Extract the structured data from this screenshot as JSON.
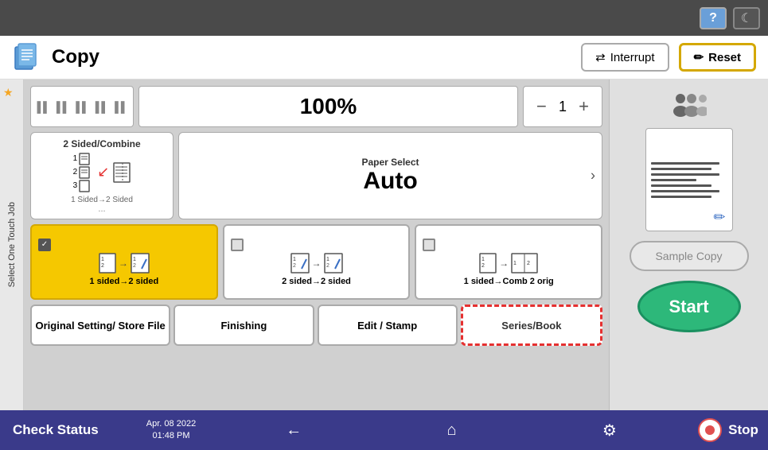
{
  "topBar": {
    "helpLabel": "?",
    "moonLabel": "☾"
  },
  "header": {
    "title": "Copy",
    "interruptLabel": "Interrupt",
    "resetLabel": "Reset"
  },
  "controls": {
    "zoomPlaceholder": "▐▌▐▌▐▌▐▌▐▌",
    "zoomValue": "100%",
    "copies": "1",
    "minusLabel": "−",
    "plusLabel": "+"
  },
  "featureCards": {
    "twoSidedCombine": {
      "title": "2 Sided/Combine",
      "sub": "1 Sided→2 Sided",
      "moreLabel": "..."
    },
    "paperSelect": {
      "title": "Paper Select",
      "value": "Auto"
    }
  },
  "duplexOptions": [
    {
      "id": "one-to-two",
      "label": "1 sided→2 sided",
      "active": true,
      "checked": true
    },
    {
      "id": "two-to-two",
      "label": "2 sided→2 sided",
      "active": false,
      "checked": false
    },
    {
      "id": "one-to-comb",
      "label": "1 sided→Comb 2 orig",
      "active": false,
      "checked": false
    }
  ],
  "tabs": [
    {
      "id": "original-setting",
      "label": "Original Setting/ Store File"
    },
    {
      "id": "finishing",
      "label": "Finishing"
    },
    {
      "id": "edit-stamp",
      "label": "Edit / Stamp"
    },
    {
      "id": "series-book",
      "label": "Series/Book",
      "highlighted": true
    }
  ],
  "rightPanel": {
    "sampleCopyLabel": "Sample Copy",
    "startLabel": "Start"
  },
  "footer": {
    "statusLabel": "Check Status",
    "date": "Apr. 08 2022",
    "time": "01:48 PM",
    "stopLabel": "Stop"
  },
  "sidebar": {
    "label": "Select One Touch Job"
  }
}
